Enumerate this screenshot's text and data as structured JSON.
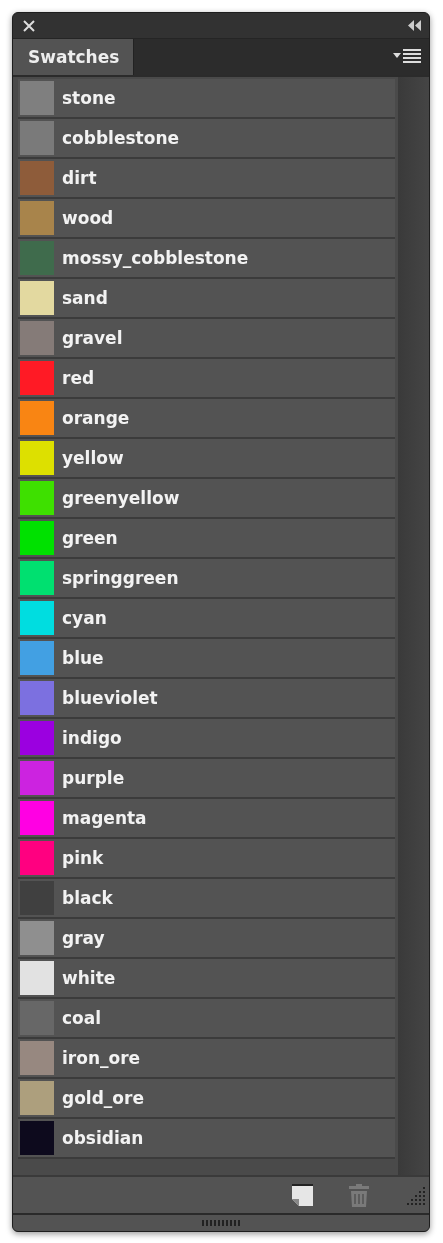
{
  "panel": {
    "tab": "Swatches"
  },
  "swatches": [
    {
      "name": "stone",
      "color": "#7f7f7f"
    },
    {
      "name": "cobblestone",
      "color": "#7a7a7a"
    },
    {
      "name": "dirt",
      "color": "#8e5c3a"
    },
    {
      "name": "wood",
      "color": "#a8844b"
    },
    {
      "name": "mossy_cobblestone",
      "color": "#3f6b4c"
    },
    {
      "name": "sand",
      "color": "#e3d9a0"
    },
    {
      "name": "gravel",
      "color": "#857b78"
    },
    {
      "name": "red",
      "color": "#ff1a25"
    },
    {
      "name": "orange",
      "color": "#f98513"
    },
    {
      "name": "yellow",
      "color": "#dde000"
    },
    {
      "name": "greenyellow",
      "color": "#3ee000"
    },
    {
      "name": "green",
      "color": "#00e100"
    },
    {
      "name": "springgreen",
      "color": "#00e070"
    },
    {
      "name": "cyan",
      "color": "#00dde0"
    },
    {
      "name": "blue",
      "color": "#42a0e3"
    },
    {
      "name": "blueviolet",
      "color": "#7c70e0"
    },
    {
      "name": "indigo",
      "color": "#9b00e0"
    },
    {
      "name": "purple",
      "color": "#cc23e0"
    },
    {
      "name": "magenta",
      "color": "#ff00e3"
    },
    {
      "name": "pink",
      "color": "#ff0080"
    },
    {
      "name": "black",
      "color": "#404040"
    },
    {
      "name": "gray",
      "color": "#8f8f8f"
    },
    {
      "name": "white",
      "color": "#e2e2e2"
    },
    {
      "name": "coal",
      "color": "#676767"
    },
    {
      "name": "iron_ore",
      "color": "#978880"
    },
    {
      "name": "gold_ore",
      "color": "#ad9f7d"
    },
    {
      "name": "obsidian",
      "color": "#0d0a1d"
    }
  ]
}
